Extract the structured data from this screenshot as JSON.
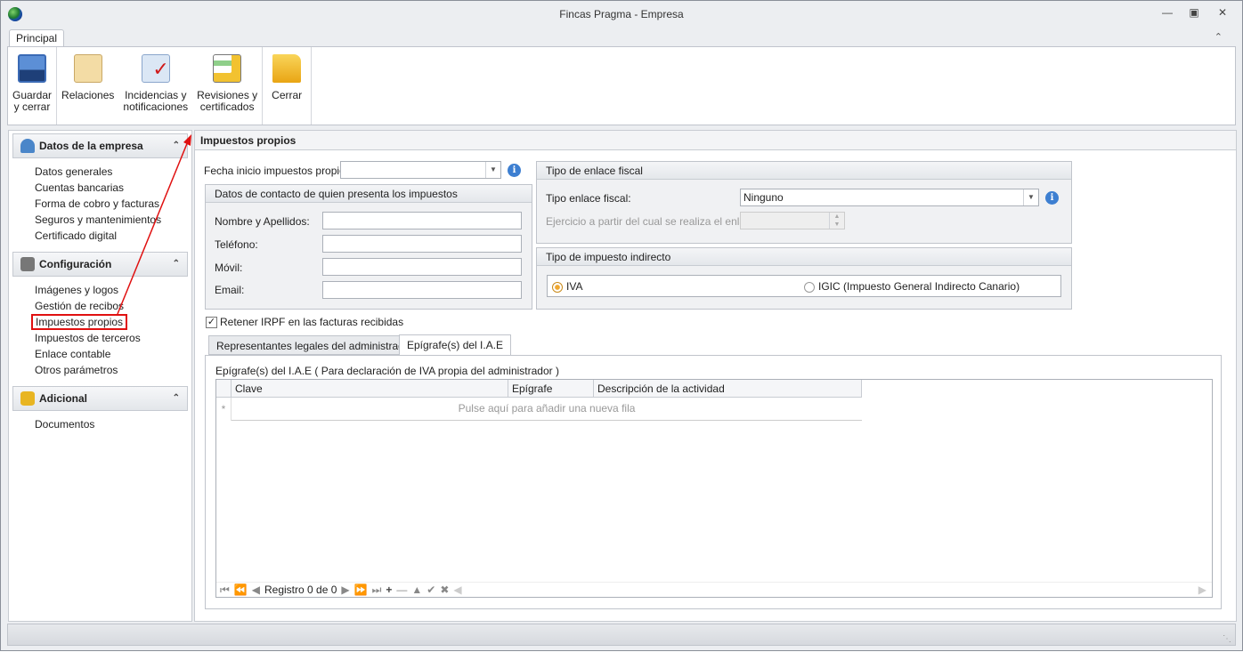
{
  "window": {
    "title": "Fincas Pragma - Empresa"
  },
  "ribbon": {
    "tab": "Principal",
    "buttons": [
      {
        "label1": "Guardar",
        "label2": "y cerrar"
      },
      {
        "label1": "Relaciones",
        "label2": ""
      },
      {
        "label1": "Incidencias y",
        "label2": "notificaciones"
      },
      {
        "label1": "Revisiones y",
        "label2": "certificados"
      },
      {
        "label1": "Cerrar",
        "label2": ""
      }
    ]
  },
  "sidebar": {
    "sections": [
      {
        "title": "Datos de la empresa",
        "items": [
          "Datos generales",
          "Cuentas bancarias",
          "Forma de cobro y facturas",
          "Seguros y mantenimientos",
          "Certificado digital"
        ]
      },
      {
        "title": "Configuración",
        "items": [
          "Imágenes y logos",
          "Gestión de recibos",
          "Impuestos propios",
          "Impuestos de terceros",
          "Enlace contable",
          "Otros parámetros"
        ]
      },
      {
        "title": "Adicional",
        "items": [
          "Documentos"
        ]
      }
    ]
  },
  "main": {
    "title": "Impuestos propios",
    "fecha_label": "Fecha inicio impuestos propios:",
    "fecha_value": "",
    "contacto": {
      "title": "Datos de contacto de quien presenta los impuestos",
      "fields": [
        {
          "label": "Nombre y Apellidos:",
          "value": ""
        },
        {
          "label": "Teléfono:",
          "value": ""
        },
        {
          "label": "Móvil:",
          "value": ""
        },
        {
          "label": "Email:",
          "value": ""
        }
      ]
    },
    "enlace": {
      "title": "Tipo de enlace fiscal",
      "tipo_label": "Tipo enlace fiscal:",
      "tipo_value": "Ninguno",
      "ejercicio_label": "Ejercicio a partir del cual se realiza el enlace:",
      "ejercicio_value": ""
    },
    "impuesto": {
      "title": "Tipo de impuesto indirecto",
      "options": [
        "IVA",
        "IGIC (Impuesto General Indirecto Canario)"
      ],
      "selected": "IVA"
    },
    "retener_label": "Retener IRPF en las facturas recibidas",
    "retener_checked": true,
    "tabs": [
      "Representantes legales del administrador",
      "Epígrafe(s) del I.A.E"
    ],
    "active_tab": "Epígrafe(s) del I.A.E",
    "grid_caption": "Epígrafe(s) del I.A.E ( Para declaración de IVA propia del administrador )",
    "columns": [
      "Clave",
      "Epígrafe",
      "Descripción de la actividad"
    ],
    "new_row": "Pulse aquí para añadir una nueva fila",
    "new_row_marker": "*",
    "record": "Registro 0 de 0"
  },
  "colors": {
    "accent_red": "#e01010",
    "radio_selected": "#f0a830"
  }
}
